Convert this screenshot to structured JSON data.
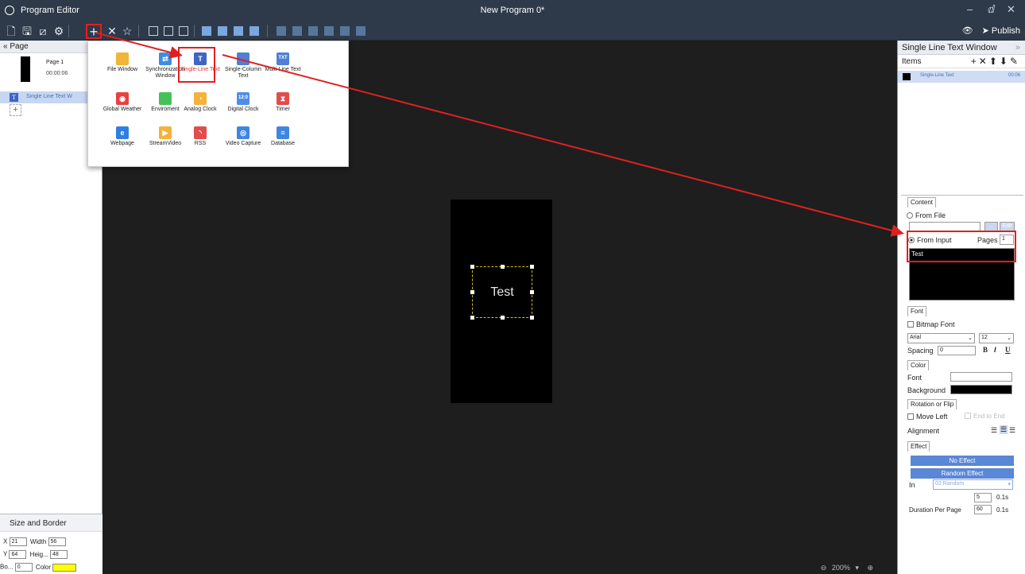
{
  "titlebar": {
    "app_title": "Program Editor",
    "doc_title": "New Program 0*",
    "min": "–",
    "restore": "ⅆ",
    "close": "✕"
  },
  "toolbar": {
    "publish_label": "Publish"
  },
  "left_panel": {
    "header": "Page",
    "page": {
      "name": "Page 1",
      "duration": "00:00:06"
    },
    "window_item": "Single Line Text W",
    "window_icon_letter": "T"
  },
  "size_border": {
    "title": "Size and Border",
    "x_label": "X",
    "x_value": "21",
    "width_label": "Width",
    "width_value": "56",
    "y_label": "Y",
    "y_value": "64",
    "height_label": "Heig...",
    "height_value": "48",
    "border_label": "Bo...",
    "border_value": "0",
    "color_label": "Color",
    "color_value": "#ffff00"
  },
  "window_menu": {
    "items": [
      {
        "label": "File Window",
        "icon": "folder-icon",
        "color": "#f1b53a",
        "glyph": ""
      },
      {
        "label": "Synchronization Window",
        "icon": "sync-icon",
        "color": "#3f8de0",
        "glyph": "⇄"
      },
      {
        "label": "Single-Line Text",
        "icon": "text-icon",
        "color": "#3d66c4",
        "glyph": "T"
      },
      {
        "label": "Single-Column Text",
        "icon": "column-text-icon",
        "color": "#4f7fd6",
        "glyph": ""
      },
      {
        "label": "Multi-Line Text",
        "icon": "multiline-text-icon",
        "color": "#4f7fd6",
        "glyph": "TXT"
      },
      {
        "label": "Global Weather",
        "icon": "globe-icon",
        "color": "#e94040",
        "glyph": "◉"
      },
      {
        "label": "Enviroment",
        "icon": "leaf-icon",
        "color": "#46c05a",
        "glyph": ""
      },
      {
        "label": "Analog Clock",
        "icon": "analog-clock-icon",
        "color": "#f4b23c",
        "glyph": "◔"
      },
      {
        "label": "Digital Clock",
        "icon": "digital-clock-icon",
        "color": "#4f8de8",
        "glyph": "12:0"
      },
      {
        "label": "Timer",
        "icon": "hourglass-icon",
        "color": "#e24c4c",
        "glyph": "⧗"
      },
      {
        "label": "Webpage",
        "icon": "browser-icon",
        "color": "#2f7fe0",
        "glyph": "e"
      },
      {
        "label": "StreamVideo",
        "icon": "video-icon",
        "color": "#f4b23c",
        "glyph": "▶"
      },
      {
        "label": "RSS",
        "icon": "rss-icon",
        "color": "#e24c4c",
        "glyph": "◝"
      },
      {
        "label": "Video Capture",
        "icon": "camera-icon",
        "color": "#3f86e0",
        "glyph": "◎"
      },
      {
        "label": "Database",
        "icon": "database-icon",
        "color": "#3f86e0",
        "glyph": "≡"
      }
    ]
  },
  "canvas": {
    "text": "Test",
    "zoom": "200%"
  },
  "right_panel": {
    "title": "Single Line Text Window",
    "items_label": "Items",
    "item_name": "Single-Line Text",
    "item_duration": "00:06",
    "content": {
      "tab": "Content",
      "from_file": "From File",
      "edit": "Edit",
      "ellipsis": "...",
      "from_input": "From Input",
      "pages_label": "Pages",
      "pages_value": "1",
      "input_text": "Test"
    },
    "font": {
      "tab": "Font",
      "bitmap": "Bitmap Font",
      "family": "Arial",
      "size": "12",
      "spacing_label": "Spacing",
      "spacing_value": "0",
      "bold": "B",
      "italic": "I",
      "underline": "U"
    },
    "color": {
      "tab": "Color",
      "font_label": "Font",
      "bg_label": "Background",
      "font_color": "#ffffff",
      "bg_color": "#000000"
    },
    "rotation": {
      "tab": "Rotation or Flip",
      "move_left": "Move Left",
      "end_to_end": "End to End",
      "alignment": "Alignment"
    },
    "effect": {
      "tab": "Effect",
      "no_effect": "No Effect",
      "random_effect": "Random Effect",
      "in_label": "In",
      "in_value": "02:Random",
      "speed_value": "5",
      "unit": "0.1s",
      "duration_label": "Duration Per Page",
      "duration_value": "60"
    }
  }
}
